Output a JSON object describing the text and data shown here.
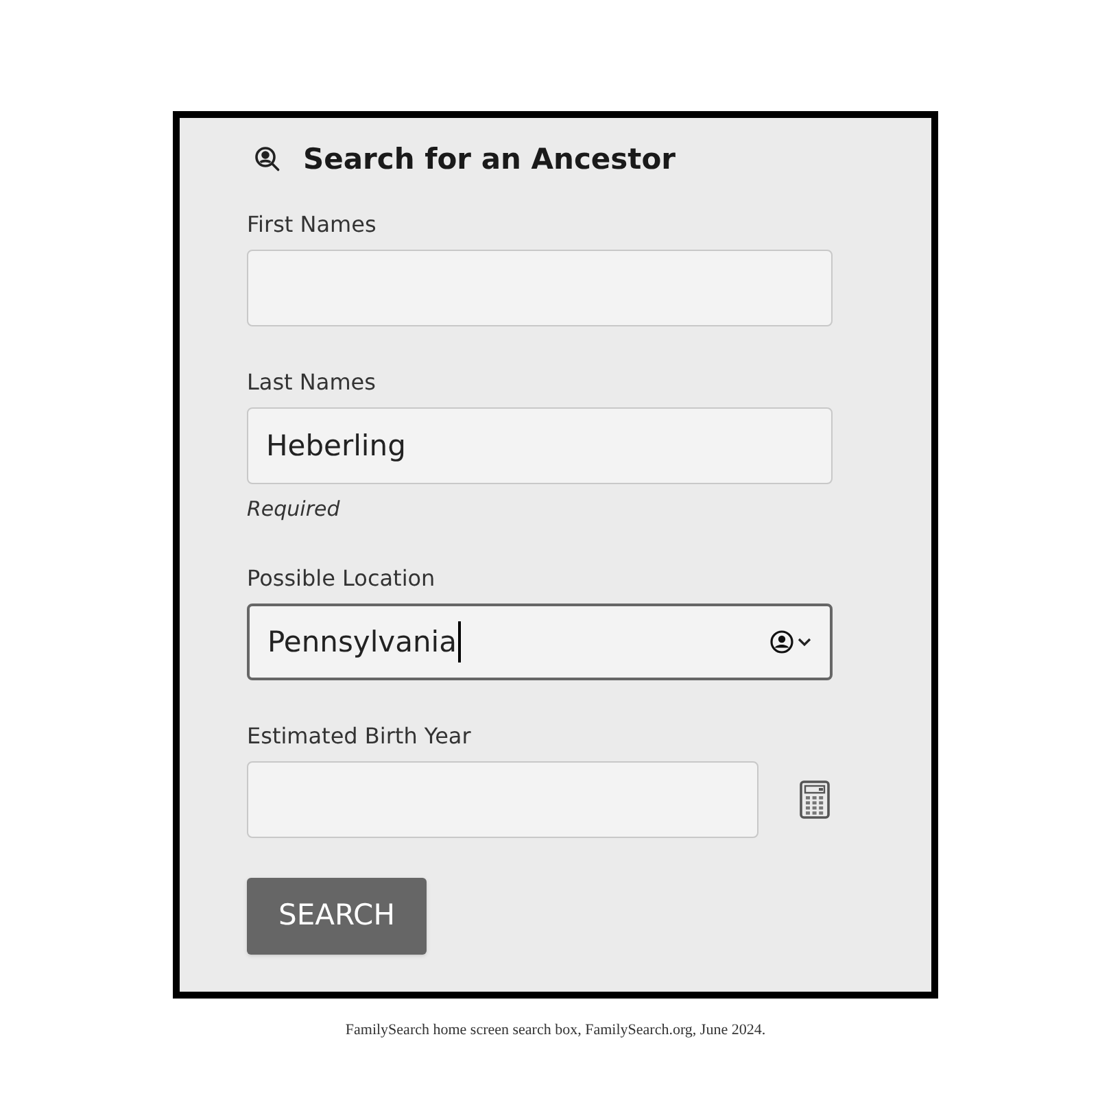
{
  "panel": {
    "title": "Search for an Ancestor"
  },
  "fields": [
    {
      "kind": "text",
      "label": "First Names",
      "focused": false
    },
    {
      "kind": "text",
      "label": "Last Names",
      "value": "Heberling",
      "hint": "Required",
      "focused": false
    },
    {
      "kind": "location",
      "label": "Possible Location",
      "value": "Pennsylvania",
      "focused": true
    },
    {
      "kind": "year",
      "label": "Estimated Birth Year",
      "focused": false
    }
  ],
  "button": {
    "label": "SEARCH"
  },
  "caption": "FamilySearch home screen search box, FamilySearch.org, June 2024."
}
